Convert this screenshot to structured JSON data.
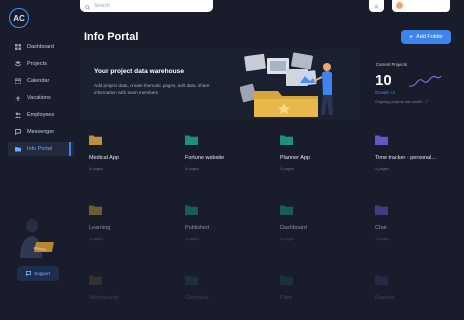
{
  "app": {
    "logo_text": "AC"
  },
  "colors": {
    "accent": "#3d84f0",
    "background": "#181c2b",
    "card": "#1b2031"
  },
  "search": {
    "placeholder": "Search"
  },
  "profile": {
    "name": ""
  },
  "sidebar": {
    "items": [
      {
        "label": "Dashboard",
        "icon": "grid-icon",
        "active": false
      },
      {
        "label": "Projects",
        "icon": "layers-icon",
        "active": false
      },
      {
        "label": "Calendar",
        "icon": "calendar-icon",
        "active": false
      },
      {
        "label": "Vacations",
        "icon": "plane-icon",
        "active": false
      },
      {
        "label": "Employees",
        "icon": "users-icon",
        "active": false
      },
      {
        "label": "Messenger",
        "icon": "chat-icon",
        "active": false
      },
      {
        "label": "Info Portal",
        "icon": "folder-icon",
        "active": true
      }
    ],
    "support_button": "Support"
  },
  "header": {
    "title": "Info Portal",
    "add_folder_label": "Add Folder"
  },
  "banner": {
    "title": "Your project data warehouse",
    "text": "Add project data, create thematic pages, edit data, share information with team members"
  },
  "stats": {
    "label": "Current Projects",
    "value": "10",
    "growth": "Growth +2",
    "note": "Ongoing projects last month - 7"
  },
  "folders": [
    {
      "name": "Medical App",
      "pages": "8 pages",
      "color": "#b8923a"
    },
    {
      "name": "Fortune website",
      "pages": "8 pages",
      "color": "#1f8f7a"
    },
    {
      "name": "Planner App",
      "pages": "5 pages",
      "color": "#1f8f7a"
    },
    {
      "name": "Time tracker - personal...",
      "pages": "4 pages",
      "color": "#6a55c7"
    },
    {
      "name": "Learning",
      "pages": "4 pages",
      "color": "#b8923a"
    },
    {
      "name": "Published",
      "pages": "4 pages",
      "color": "#1f8f7a"
    },
    {
      "name": "Dashboard",
      "pages": "4 pages",
      "color": "#1f8f7a"
    },
    {
      "name": "Chat",
      "pages": "4 pages",
      "color": "#6a55c7"
    },
    {
      "name": "Storyboards",
      "pages": "",
      "color": "#b8923a"
    },
    {
      "name": "Contracts",
      "pages": "",
      "color": "#1f8f7a"
    },
    {
      "name": "Files",
      "pages": "",
      "color": "#1f8f7a"
    },
    {
      "name": "Reports",
      "pages": "",
      "color": "#6a55c7"
    }
  ]
}
